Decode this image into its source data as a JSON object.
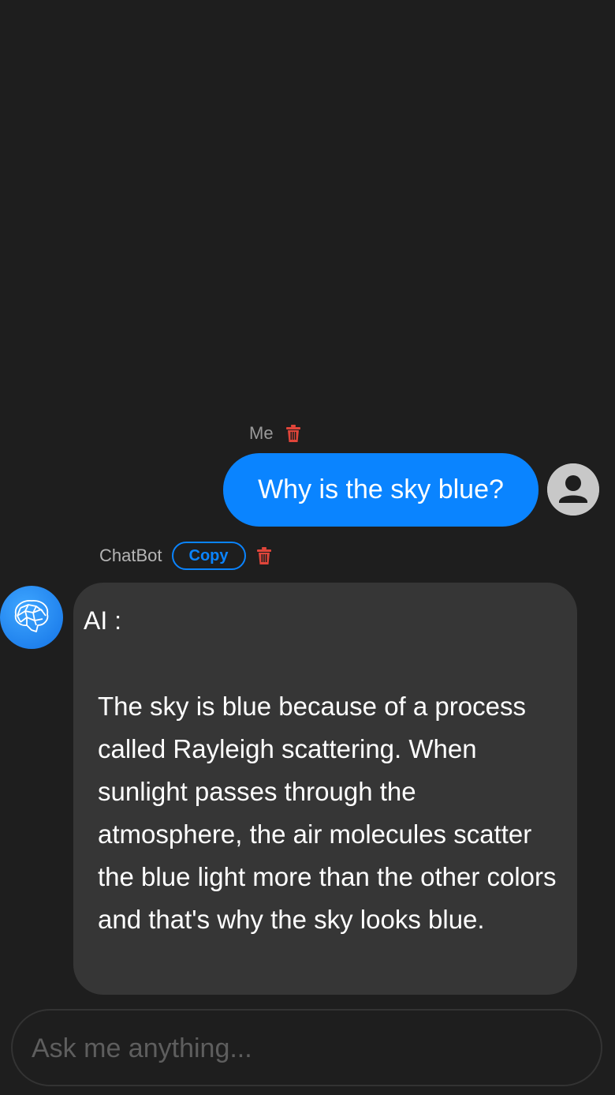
{
  "colors": {
    "background": "#1e1e1e",
    "accent": "#0a84ff",
    "bot_bubble": "#363636",
    "danger": "#e0453a"
  },
  "user_message": {
    "sender": "Me",
    "text": "Why is the sky blue?",
    "avatar_icon": "person-icon",
    "delete_icon": "trash-icon"
  },
  "bot_message": {
    "sender": "ChatBot",
    "copy_label": "Copy",
    "delete_icon": "trash-icon",
    "avatar_icon": "brain-icon",
    "prefix": "AI :",
    "text": "The sky is blue because of a process called Rayleigh scattering. When sunlight passes through the atmosphere, the air molecules scatter the blue light more than the other colors and that's why the sky looks blue."
  },
  "input": {
    "placeholder": "Ask me anything..."
  }
}
